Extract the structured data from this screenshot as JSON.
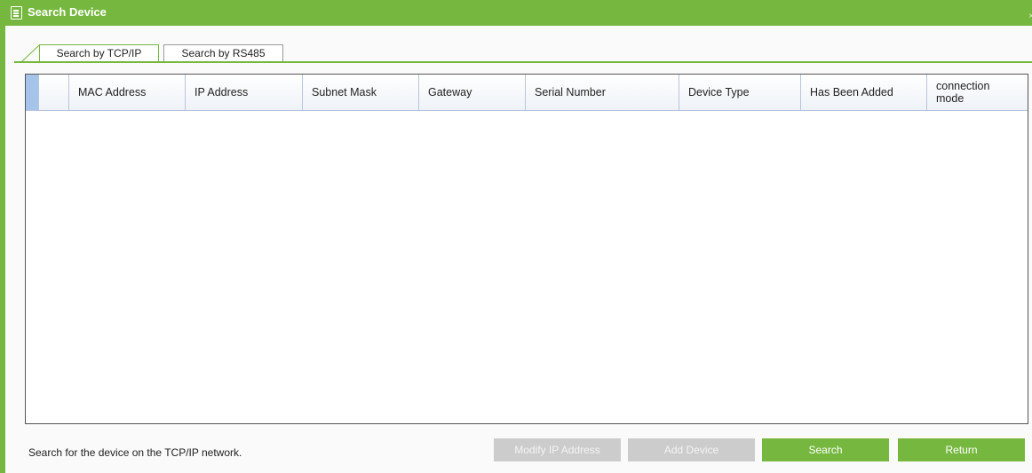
{
  "window": {
    "title": "Search Device",
    "close_label": "×"
  },
  "tabs": [
    {
      "label": "Search by TCP/IP",
      "active": true
    },
    {
      "label": "Search by RS485",
      "active": false
    }
  ],
  "table": {
    "columns": [
      "MAC Address",
      "IP Address",
      "Subnet Mask",
      "Gateway",
      "Serial Number",
      "Device Type",
      "Has Been Added",
      "connection mode"
    ],
    "rows": []
  },
  "footer": {
    "status_text": "Search for the device on the TCP/IP network.",
    "buttons": {
      "modify_ip": "Modify IP Address",
      "add_device": "Add Device",
      "search": "Search",
      "return": "Return"
    }
  },
  "colors": {
    "accent": "#76b83f",
    "disabled": "#cccccc",
    "header_selector": "#a6c3ea"
  }
}
